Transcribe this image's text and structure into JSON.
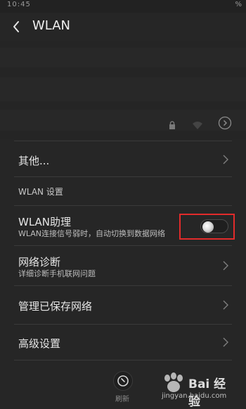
{
  "status_bar": {
    "left": "10:45",
    "right": "%"
  },
  "header": {
    "title": "WLAN"
  },
  "menu": {
    "other": {
      "label": "其他..."
    },
    "section_title": "WLAN 设置",
    "wlan_assistant": {
      "label": "WLAN助理",
      "subtitle": "WLAN连接信号弱时，自动切换到数据网络",
      "enabled": false
    },
    "network_diagnosis": {
      "label": "网络诊断",
      "subtitle": "详细诊断手机联网问题"
    },
    "manage_saved": {
      "label": "管理已保存网络"
    },
    "advanced": {
      "label": "高级设置"
    }
  },
  "bottom": {
    "refresh_label": "刷新"
  },
  "watermark": {
    "brand": "Bai 经验",
    "domain": "jingyan.baidu.com"
  },
  "colors": {
    "highlight_box": "#e22b2b",
    "background": "#262626"
  }
}
